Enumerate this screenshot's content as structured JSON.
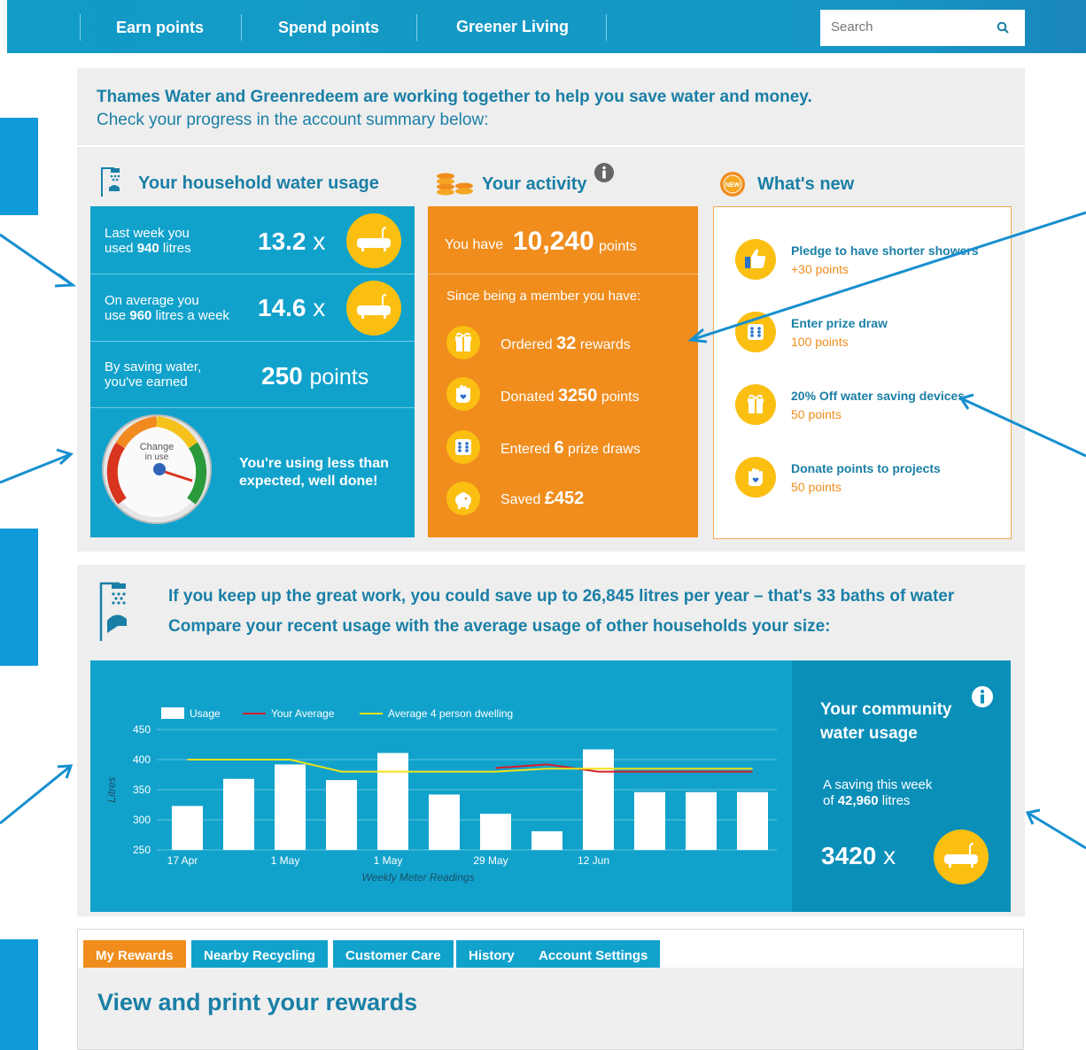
{
  "nav": {
    "items": [
      "Earn points",
      "Spend points",
      "Greener Living"
    ],
    "search_placeholder": "Search"
  },
  "intro": {
    "line1": "Thames Water and Greenredeem are working together to help you save water and money.",
    "line2": "Check your progress in the account summary below:"
  },
  "household": {
    "title": "Your household water usage",
    "last_week_label_1": "Last week you",
    "last_week_label_2a": "used ",
    "last_week_litres": "940",
    "last_week_label_2b": " litres",
    "last_week_value": "13.2",
    "average_label_1": "On average you",
    "average_label_2a": "use ",
    "average_litres": "960",
    "average_label_2b": " litres a week",
    "average_value": "14.6",
    "times": "x",
    "saving_label_1": "By saving water,",
    "saving_label_2": "you've earned",
    "saving_points": "250",
    "points_word": "points",
    "gauge_label_1": "Change",
    "gauge_label_2": "in use",
    "message_1": "You're using less than",
    "message_2": "expected, well done!"
  },
  "activity": {
    "title": "Your activity",
    "you_have": "You have",
    "points_total": "10,240",
    "points_word": "points",
    "since": "Since being a member you have:",
    "items": [
      {
        "pre": "Ordered ",
        "value": "32",
        "post": " rewards",
        "icon": "gift-icon"
      },
      {
        "pre": "Donated ",
        "value": "3250",
        "post": " points",
        "icon": "donate-hand-icon"
      },
      {
        "pre": "Entered ",
        "value": "6",
        "post": " prize draws",
        "icon": "dice-icon"
      },
      {
        "pre": "Saved ",
        "value": "£452",
        "post": "",
        "icon": "piggy-bank-icon"
      }
    ]
  },
  "whatsnew": {
    "title": "What's new",
    "badge": "NEW",
    "items": [
      {
        "title": "Pledge to have shorter showers",
        "sub": "+30 points",
        "icon": "thumbs-up-icon"
      },
      {
        "title": "Enter prize draw",
        "sub": "100 points",
        "icon": "dice-icon"
      },
      {
        "title": "20% Off water saving devices",
        "sub": "50 points",
        "icon": "gift-icon"
      },
      {
        "title": "Donate points to projects",
        "sub": "50 points",
        "icon": "donate-hand-icon"
      }
    ]
  },
  "savings": {
    "line1": "If you keep up the great work, you could save up to 26,845 litres per year – that's 33 baths of water",
    "line2": "Compare your recent usage with the average usage of other households your size:"
  },
  "chart_data": {
    "type": "bar",
    "title": "",
    "xlabel": "Weekly Meter Readings",
    "ylabel": "Litres",
    "ylim": [
      250,
      450
    ],
    "yticks": [
      250,
      300,
      350,
      400,
      450
    ],
    "xtick_labels": [
      "17 Apr",
      "1 May",
      "1 May",
      "29  May",
      "12 Jun"
    ],
    "xtick_positions": [
      0,
      2,
      4,
      6,
      8
    ],
    "legend": [
      {
        "name": "Usage",
        "color": "#ffffff",
        "kind": "bar"
      },
      {
        "name": "Your Average",
        "color": "#d21f2b",
        "kind": "line"
      },
      {
        "name": "Average 4 person dwelling",
        "color": "#f2e21a",
        "kind": "line"
      }
    ],
    "series": [
      {
        "name": "Usage",
        "type": "bar",
        "values": [
          323,
          368,
          392,
          366,
          411,
          342,
          310,
          281,
          417,
          346,
          346,
          346
        ]
      },
      {
        "name": "Your Average",
        "type": "line",
        "values": [
          null,
          null,
          null,
          null,
          null,
          null,
          386,
          392,
          380,
          380,
          380,
          380
        ]
      },
      {
        "name": "Average 4 person dwelling",
        "type": "line",
        "values": [
          400,
          400,
          400,
          380,
          380,
          380,
          380,
          385,
          385,
          385,
          385,
          385
        ]
      }
    ],
    "grid": true,
    "legend_position": "top"
  },
  "community": {
    "title_1": "Your community",
    "title_2": "water usage",
    "saving_1": "A saving this week",
    "saving_2a": "of ",
    "saving_litres": "42,960",
    "saving_2b": " litres",
    "value": "3420",
    "times": "x"
  },
  "tabs": [
    "My Rewards",
    "Nearby Recycling",
    "Customer Care",
    "History",
    "Account Settings"
  ],
  "rewards_title": "View and print your rewards",
  "colors": {
    "blue": "#11a2cc",
    "orange": "#f08d1d",
    "yellow": "#fbbf12",
    "text_blue": "#1a7fa6"
  }
}
